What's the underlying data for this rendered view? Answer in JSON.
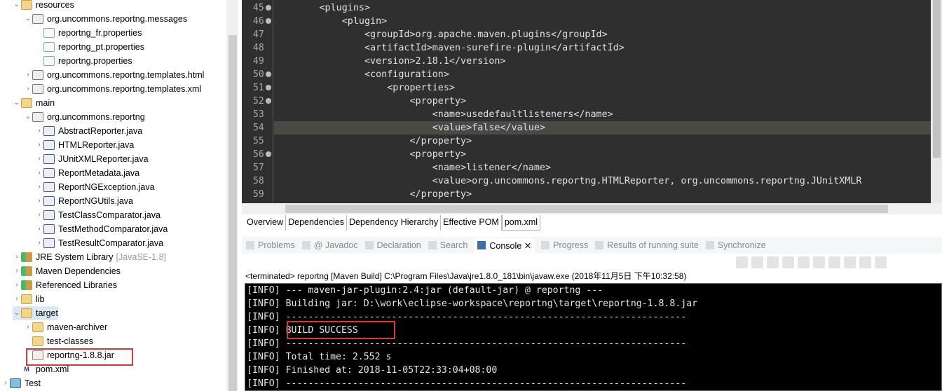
{
  "explorer": {
    "items": [
      {
        "label": "resources",
        "level": 1,
        "chevron": "down",
        "icon": "folder"
      },
      {
        "label": "org.uncommons.reportng.messages",
        "level": 2,
        "chevron": "down",
        "icon": "pkg"
      },
      {
        "label": "reportng_fr.properties",
        "level": 3,
        "chevron": "",
        "icon": "file"
      },
      {
        "label": "reportng_pt.properties",
        "level": 3,
        "chevron": "",
        "icon": "file"
      },
      {
        "label": "reportng.properties",
        "level": 3,
        "chevron": "",
        "icon": "file"
      },
      {
        "label": "org.uncommons.reportng.templates.html",
        "level": 2,
        "chevron": "right",
        "icon": "pkg"
      },
      {
        "label": "org.uncommons.reportng.templates.xml",
        "level": 2,
        "chevron": "right",
        "icon": "pkg"
      },
      {
        "label": "main",
        "level": 1,
        "chevron": "down",
        "icon": "folder"
      },
      {
        "label": "org.uncommons.reportng",
        "level": 2,
        "chevron": "down",
        "icon": "pkg"
      },
      {
        "label": "AbstractReporter.java",
        "level": 3,
        "chevron": "right",
        "icon": "java"
      },
      {
        "label": "HTMLReporter.java",
        "level": 3,
        "chevron": "right",
        "icon": "java"
      },
      {
        "label": "JUnitXMLReporter.java",
        "level": 3,
        "chevron": "right",
        "icon": "java"
      },
      {
        "label": "ReportMetadata.java",
        "level": 3,
        "chevron": "right",
        "icon": "java"
      },
      {
        "label": "ReportNGException.java",
        "level": 3,
        "chevron": "right",
        "icon": "java"
      },
      {
        "label": "ReportNGUtils.java",
        "level": 3,
        "chevron": "right",
        "icon": "java"
      },
      {
        "label": "TestClassComparator.java",
        "level": 3,
        "chevron": "right",
        "icon": "java"
      },
      {
        "label": "TestMethodComparator.java",
        "level": 3,
        "chevron": "right",
        "icon": "java"
      },
      {
        "label": "TestResultComparator.java",
        "level": 3,
        "chevron": "right",
        "icon": "java"
      },
      {
        "label": "JRE System Library",
        "suffix": "[JavaSE-1.8]",
        "level": 1,
        "chevron": "right",
        "icon": "lib"
      },
      {
        "label": "Maven Dependencies",
        "level": 1,
        "chevron": "right",
        "icon": "lib"
      },
      {
        "label": "Referenced Libraries",
        "level": 1,
        "chevron": "right",
        "icon": "lib"
      },
      {
        "label": "lib",
        "level": 1,
        "chevron": "right",
        "icon": "folder"
      },
      {
        "label": "target",
        "level": 1,
        "chevron": "down",
        "icon": "folder",
        "selected": true
      },
      {
        "label": "maven-archiver",
        "level": 2,
        "chevron": "right",
        "icon": "folder"
      },
      {
        "label": "test-classes",
        "level": 2,
        "chevron": "",
        "icon": "folder"
      },
      {
        "label": "reportng-1.8.8.jar",
        "level": 2,
        "chevron": "",
        "icon": "jar",
        "highlighted": true
      },
      {
        "label": "pom.xml",
        "level": 1,
        "chevron": "",
        "icon": "pom"
      },
      {
        "label": "Test",
        "level": 0,
        "chevron": "right",
        "icon": "proj"
      }
    ]
  },
  "editor": {
    "lines": [
      {
        "n": "45",
        "fold": true,
        "text": "        <plugins>"
      },
      {
        "n": "46",
        "fold": true,
        "text": "            <plugin>"
      },
      {
        "n": "47",
        "fold": false,
        "text": "                <groupId>org.apache.maven.plugins</groupId>"
      },
      {
        "n": "48",
        "fold": false,
        "text": "                <artifactId>maven-surefire-plugin</artifactId>"
      },
      {
        "n": "49",
        "fold": false,
        "text": "                <version>2.18.1</version>"
      },
      {
        "n": "50",
        "fold": true,
        "text": "                <configuration>"
      },
      {
        "n": "51",
        "fold": true,
        "text": "                    <properties>"
      },
      {
        "n": "52",
        "fold": true,
        "text": "                        <property>"
      },
      {
        "n": "53",
        "fold": false,
        "text": "                            <name>usedefaultlisteners</name>"
      },
      {
        "n": "54",
        "fold": false,
        "text": "                            <value>false</value>",
        "current": true
      },
      {
        "n": "55",
        "fold": false,
        "text": "                        </property>"
      },
      {
        "n": "56",
        "fold": true,
        "text": "                        <property>"
      },
      {
        "n": "57",
        "fold": false,
        "text": "                            <name>listener</name>"
      },
      {
        "n": "58",
        "fold": false,
        "text": "                            <value>org.uncommons.reportng.HTMLReporter, org.uncommons.reportng.JUnitXMLR"
      },
      {
        "n": "59",
        "fold": false,
        "text": "                        </property>"
      }
    ]
  },
  "pom_tabs": [
    {
      "label": "Overview"
    },
    {
      "label": "Dependencies"
    },
    {
      "label": "Dependency Hierarchy"
    },
    {
      "label": "Effective POM"
    },
    {
      "label": "pom.xml",
      "active": true
    }
  ],
  "view_tabs": [
    {
      "label": "Problems"
    },
    {
      "label": "@ Javadoc"
    },
    {
      "label": "Declaration"
    },
    {
      "label": "Search"
    },
    {
      "label": "Console ✕",
      "active": true
    },
    {
      "label": "Progress"
    },
    {
      "label": "Results of running suite"
    },
    {
      "label": "Synchronize"
    }
  ],
  "console": {
    "status": "<terminated> reportng [Maven Build] C:\\Program Files\\Java\\jre1.8.0_181\\bin\\javaw.exe (2018年11月5日 下午10:32:58)",
    "lines": [
      "[INFO] --- maven-jar-plugin:2.4:jar (default-jar) @ reportng ---",
      "[INFO] Building jar: D:\\work\\eclipse-workspace\\reportng\\target\\reportng-1.8.8.jar",
      "[INFO] ------------------------------------------------------------------------",
      "[INFO] BUILD SUCCESS",
      "[INFO] ------------------------------------------------------------------------",
      "[INFO] Total time: 2.552 s",
      "[INFO] Finished at: 2018-11-05T22:33:04+08:00",
      "[INFO] ------------------------------------------------------------------------"
    ]
  },
  "colors": {
    "highlight_box": "#d9383a",
    "editor_bg": "#2f2f2f",
    "console_bg": "#000000"
  }
}
